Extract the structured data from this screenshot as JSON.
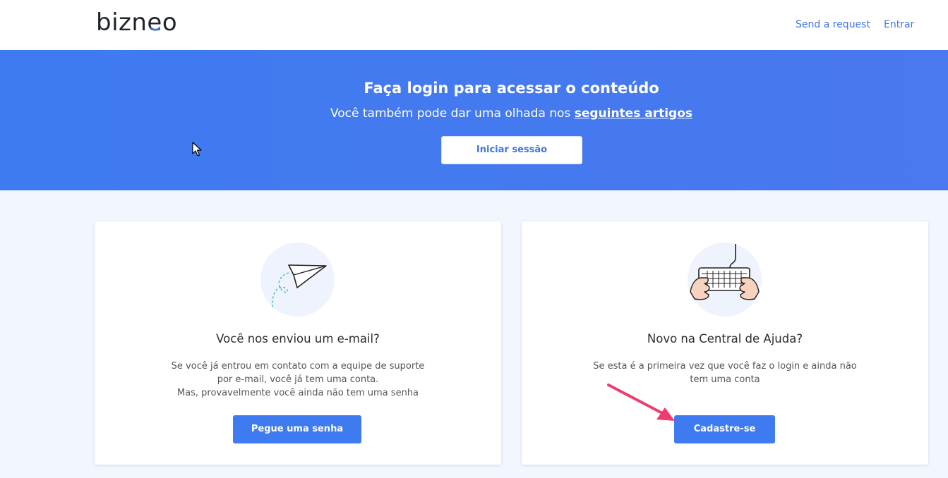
{
  "header": {
    "logo_text": "bizneo",
    "nav": {
      "request_label": "Send a request",
      "login_label": "Entrar"
    }
  },
  "hero": {
    "title": "Faça login para acessar o conteúdo",
    "subtitle_prefix": "Você também pode dar uma olhada nos ",
    "subtitle_link": "seguintes artigos",
    "button_label": "Iniciar sessão"
  },
  "cards": [
    {
      "icon": "paper-plane-icon",
      "title": "Você nos enviou um e-mail?",
      "text_lines": [
        "Se você já entrou em contato com a equipe de suporte",
        "por e-mail, você já tem uma conta.",
        "Mas, provavelmente você ainda não tem uma senha"
      ],
      "button_label": "Pegue uma senha"
    },
    {
      "icon": "keyboard-icon",
      "title": "Novo na Central de Ajuda?",
      "text_lines": [
        "Se esta é a primeira vez que você faz o login e ainda não",
        "tem uma conta"
      ],
      "button_label": "Cadastre-se"
    }
  ],
  "colors": {
    "accent": "#3e7bf0",
    "hero_bg": "#4479ef",
    "page_bg": "#f1f6ff",
    "annotation_arrow": "#ee3c6e"
  }
}
